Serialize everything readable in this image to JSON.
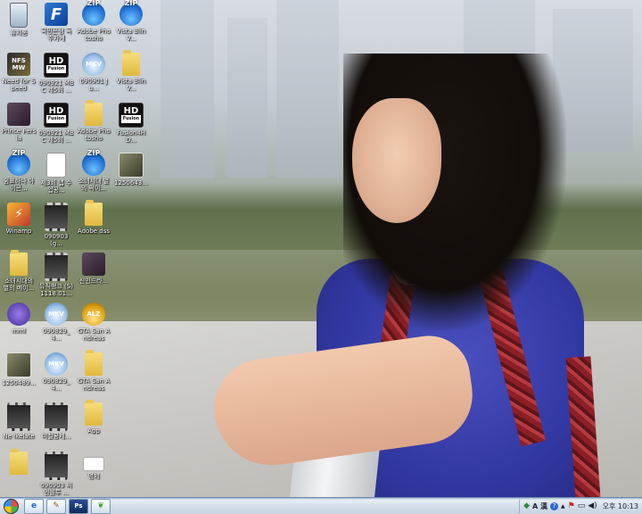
{
  "desktop": {
    "icons": [
      {
        "name": "recycle-bin",
        "label": "휴지통",
        "glyph": ""
      },
      {
        "name": "app-f",
        "label": "국민은행 독주가계",
        "glyph": "F"
      },
      {
        "name": "zip-1",
        "label": "Adobe Photosho",
        "glyph": "ZIP"
      },
      {
        "name": "zip-2",
        "label": "Vista BlinV...",
        "glyph": "ZIP"
      },
      {
        "name": "nfs",
        "label": "Need for Speed",
        "glyph": "NFS MW"
      },
      {
        "name": "hd-1",
        "label": "090921 MBC 제5회 ...",
        "glyph": "HD"
      },
      {
        "name": "mkv-1",
        "label": "090901 Ju...",
        "glyph": "MKV"
      },
      {
        "name": "folder-1",
        "label": "Vista BlinV...",
        "glyph": ""
      },
      {
        "name": "prince",
        "label": "Prince Persia",
        "glyph": ""
      },
      {
        "name": "hd-2",
        "label": "090921 MBC 제5회 ...",
        "glyph": "HD"
      },
      {
        "name": "folder-2",
        "label": "Adobe Photosho",
        "glyph": ""
      },
      {
        "name": "hd-3",
        "label": "Fusion4HD...",
        "glyph": "HD"
      },
      {
        "name": "zip-3",
        "label": "쉼표하나 아이콘...",
        "glyph": "ZIP"
      },
      {
        "name": "doc-1",
        "label": "제3회 앱 수업공...",
        "glyph": "TXT"
      },
      {
        "name": "zip-4",
        "label": "소녀시대 별의 퍽이...",
        "glyph": "ZIP"
      },
      {
        "name": "photo-1",
        "label": "1250643...",
        "glyph": ""
      },
      {
        "name": "winamp",
        "label": "Winamp",
        "glyph": "⚡"
      },
      {
        "name": "video-1",
        "label": "090903 (g...",
        "glyph": ""
      },
      {
        "name": "folder-3",
        "label": "Adobe dss",
        "glyph": ""
      },
      {
        "name": "folder-4",
        "label": "소녀시대의 별의 메이...",
        "glyph": ""
      },
      {
        "name": "video-2",
        "label": "뮤직뱅크 (S) 1118.01...",
        "glyph": ""
      },
      {
        "name": "poster-1",
        "label": "신인드라...",
        "glyph": ""
      },
      {
        "name": "mmi",
        "label": "mml",
        "glyph": ""
      },
      {
        "name": "mkv-2",
        "label": "090829_4...",
        "glyph": "MKV"
      },
      {
        "name": "alz",
        "label": "GTA San Andreas",
        "glyph": "ALZ"
      },
      {
        "name": "photo-2",
        "label": "1250489...",
        "glyph": ""
      },
      {
        "name": "mkv-3",
        "label": "090829_4...",
        "glyph": "MKV"
      },
      {
        "name": "folder-5",
        "label": "GTA San Andreas",
        "glyph": ""
      },
      {
        "name": "video-3",
        "label": "Ne Ikelate",
        "glyph": ""
      },
      {
        "name": "video-4",
        "label": "미칠공세...",
        "glyph": ""
      },
      {
        "name": "folder-6",
        "label": "App",
        "glyph": ""
      },
      {
        "name": "folder-7",
        "label": "",
        "glyph": ""
      },
      {
        "name": "video-5",
        "label": "090903 씨엔블루 ...",
        "glyph": ""
      },
      {
        "name": "card",
        "label": "명제",
        "glyph": ""
      }
    ]
  },
  "taskbar": {
    "quick_launch": [
      {
        "name": "ie-launch",
        "glyph": "e"
      },
      {
        "name": "tool-launch",
        "glyph": "✎"
      },
      {
        "name": "photoshop-launch",
        "glyph": "Ps"
      },
      {
        "name": "leaf-launch",
        "glyph": "❦"
      }
    ],
    "tray": {
      "ime": "A 漢",
      "help": "?",
      "clock": "오후 10:13"
    }
  }
}
